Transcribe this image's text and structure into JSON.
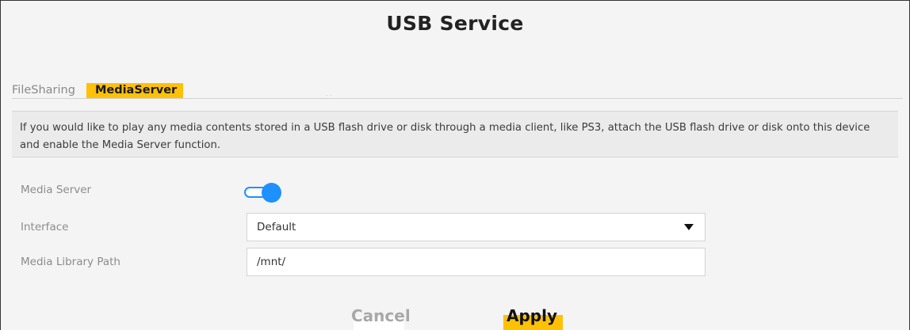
{
  "page": {
    "title": "USB Service"
  },
  "tabs": [
    {
      "label": "FileSharing",
      "active": false
    },
    {
      "label": "MediaServer",
      "active": true
    }
  ],
  "info": {
    "text": "If you would like to play any media contents stored in a USB flash drive or disk through a media client, like PS3, attach the USB flash drive or disk onto this device and enable the Media Server function."
  },
  "form": {
    "media_server": {
      "label": "Media Server",
      "enabled": true
    },
    "interface": {
      "label": "Interface",
      "value": "Default"
    },
    "library_path": {
      "label": "Media Library Path",
      "value": "/mnt/"
    }
  },
  "actions": {
    "cancel_label": "Cancel",
    "apply_label": "Apply"
  },
  "colors": {
    "accent": "#ffc107",
    "toggle_on": "#1e90ff",
    "panel_bg": "#f4f4f4"
  },
  "icons": {
    "dropdown": "caret-down-icon"
  }
}
